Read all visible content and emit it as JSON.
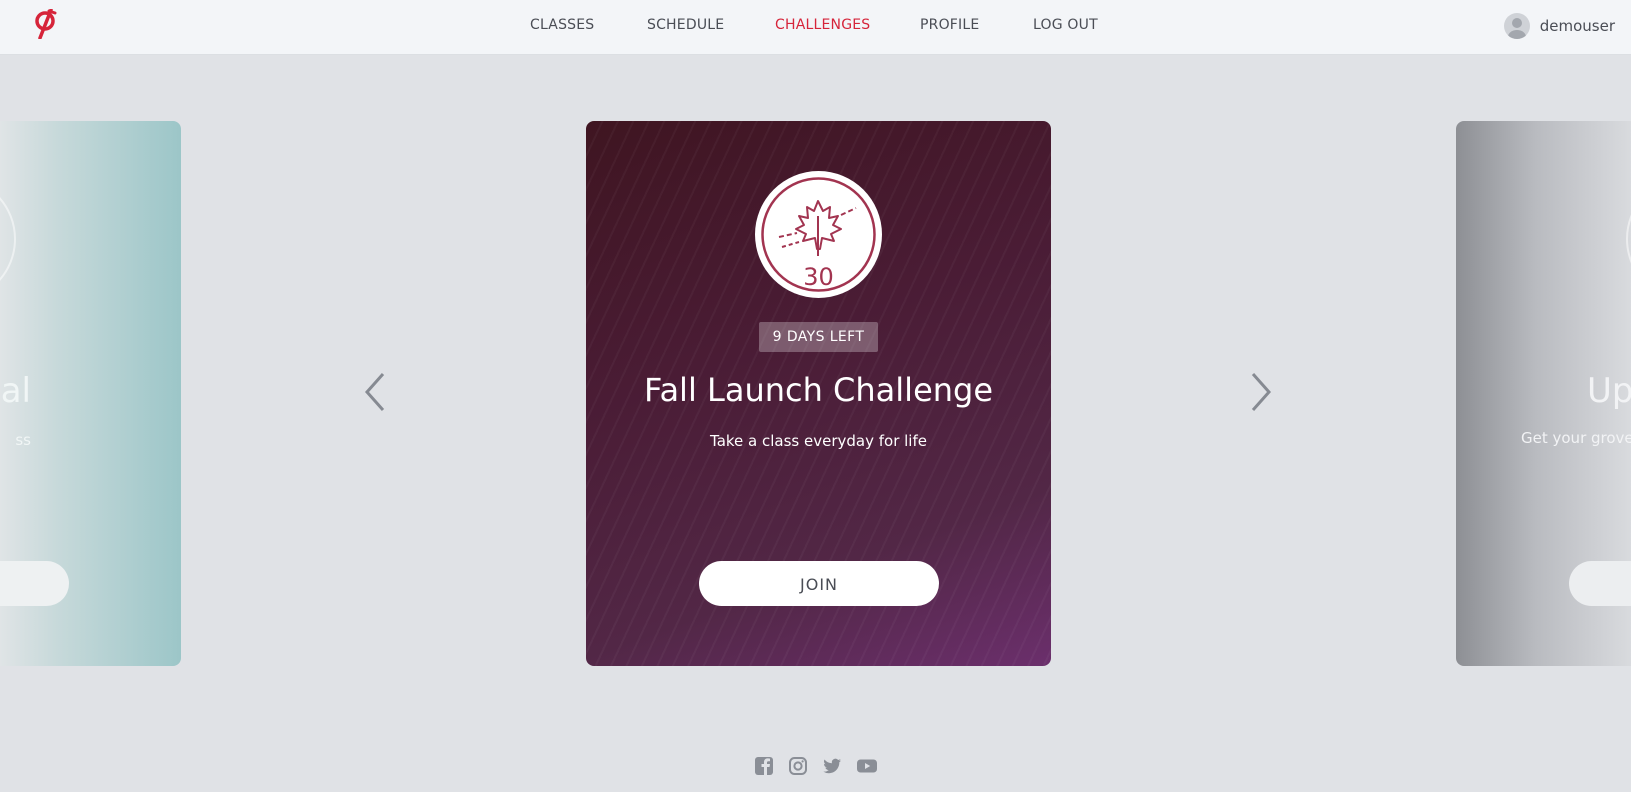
{
  "nav": {
    "items": [
      {
        "label": "CLASSES",
        "active": false
      },
      {
        "label": "SCHEDULE",
        "active": false
      },
      {
        "label": "CHALLENGES",
        "active": true
      },
      {
        "label": "PROFILE",
        "active": false
      },
      {
        "label": "LOG OUT",
        "active": false
      }
    ],
    "active_color": "#d6243a"
  },
  "user": {
    "name": "demouser",
    "icon": "avatar-icon"
  },
  "carousel": {
    "previous_card": {
      "title_fragment": "al",
      "subtitle_fragment": "ss"
    },
    "current_card": {
      "badge_number": "30",
      "badge_icon": "maple-leaf-icon",
      "days_left": "9 DAYS LEFT",
      "title": "Fall Launch Challenge",
      "subtitle": "Take a class everyday for life",
      "button_label": "JOIN"
    },
    "next_card": {
      "title_fragment": "Up",
      "subtitle_fragment": "Get your grove"
    }
  },
  "footer": {
    "icons": [
      "facebook-icon",
      "instagram-icon",
      "twitter-icon",
      "youtube-icon"
    ]
  }
}
